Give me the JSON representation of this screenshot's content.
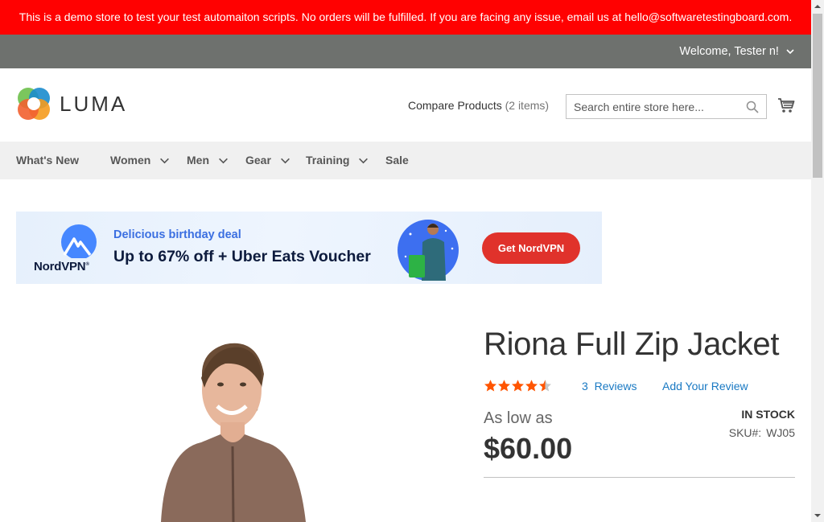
{
  "notice": "This is a demo store to test your test automaiton scripts. No orders will be fulfilled. If you are facing any issue, email us at hello@softwaretestingboard.com.",
  "header": {
    "welcome": "Welcome, Tester n!",
    "logo_text": "LUMA",
    "compare_label": "Compare Products",
    "compare_count": "(2 items)",
    "search_placeholder": "Search entire store here..."
  },
  "nav": {
    "items": [
      {
        "label": "What's New"
      },
      {
        "label": "Women"
      },
      {
        "label": "Men"
      },
      {
        "label": "Gear"
      },
      {
        "label": "Training"
      },
      {
        "label": "Sale"
      }
    ]
  },
  "banner": {
    "brand": "NordVPN",
    "subtitle": "Delicious birthday deal",
    "headline": "Up to 67% off + Uber Eats Voucher",
    "cta": "Get NordVPN",
    "brand_color": "#e0322b"
  },
  "product": {
    "name": "Riona Full Zip Jacket",
    "rating": 4.5,
    "rating_max": 5,
    "reviews_count": "3",
    "reviews_label": "Reviews",
    "add_review": "Add Your Review",
    "price_label": "As low as",
    "price": "$60.00",
    "stock": "IN STOCK",
    "sku_label": "SKU#:",
    "sku": "WJ05"
  },
  "colors": {
    "notice_bg": "#ff0101",
    "header_bar": "#6e716e",
    "link": "#1979c3",
    "star": "#ff5501"
  }
}
